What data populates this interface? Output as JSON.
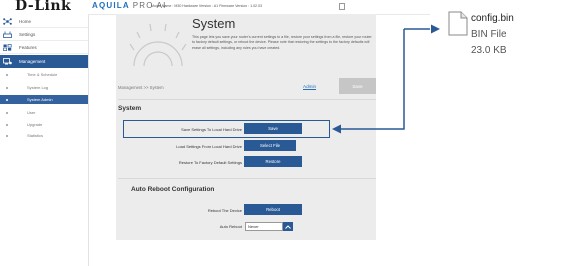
{
  "brand": {
    "logo": "D-Link",
    "product": "AQUILA",
    "product_suffix": "PRO AI"
  },
  "header": {
    "model_info": "Model Name : M30 Hardware Version : A1 Firmware Version : 1.02.03"
  },
  "sidebar": {
    "items": [
      {
        "label": "Home",
        "icon": "home-network-icon"
      },
      {
        "label": "Settings",
        "icon": "router-icon"
      },
      {
        "label": "Features",
        "icon": "features-icon"
      },
      {
        "label": "Management",
        "icon": "management-icon",
        "active": true
      }
    ],
    "subitems": [
      {
        "label": "Time & Schedule"
      },
      {
        "label": "System Log"
      },
      {
        "label": "System Admin",
        "active": true
      },
      {
        "label": "User"
      },
      {
        "label": "Upgrade"
      },
      {
        "label": "Statistics"
      }
    ]
  },
  "page": {
    "title": "System",
    "description": "This page lets you save your router's current settings to a file, restore your settings from a file, restore your router to factory default settings, or reboot the device. Please note that restoring the settings to the factory defaults will erase all settings, including any rules you have created.",
    "breadcrumb": "Management >> System",
    "admin_link": "Admin",
    "save_button": "Save"
  },
  "system_section": {
    "heading": "System",
    "rows": [
      {
        "label": "Save Settings To Local Hard Drive",
        "button": "Save"
      },
      {
        "label": "Load Settings From Local Hard Drive",
        "button": "Select File"
      },
      {
        "label": "Restore To Factory Default Settings",
        "button": "Restore"
      }
    ]
  },
  "reboot_section": {
    "heading": "Auto Reboot Configuration",
    "reboot_label": "Reboot The Device",
    "reboot_button": "Reboot",
    "auto_reboot_label": "Auto Reboot",
    "auto_reboot_value": "Never"
  },
  "file": {
    "name": "config.bin",
    "type": "BIN File",
    "size": "23.0 KB",
    "icon": "file-icon"
  },
  "colors": {
    "accent": "#2a5a96",
    "highlight_border": "#2a5a96",
    "panel": "#ececec",
    "link": "#1f6fbd"
  }
}
